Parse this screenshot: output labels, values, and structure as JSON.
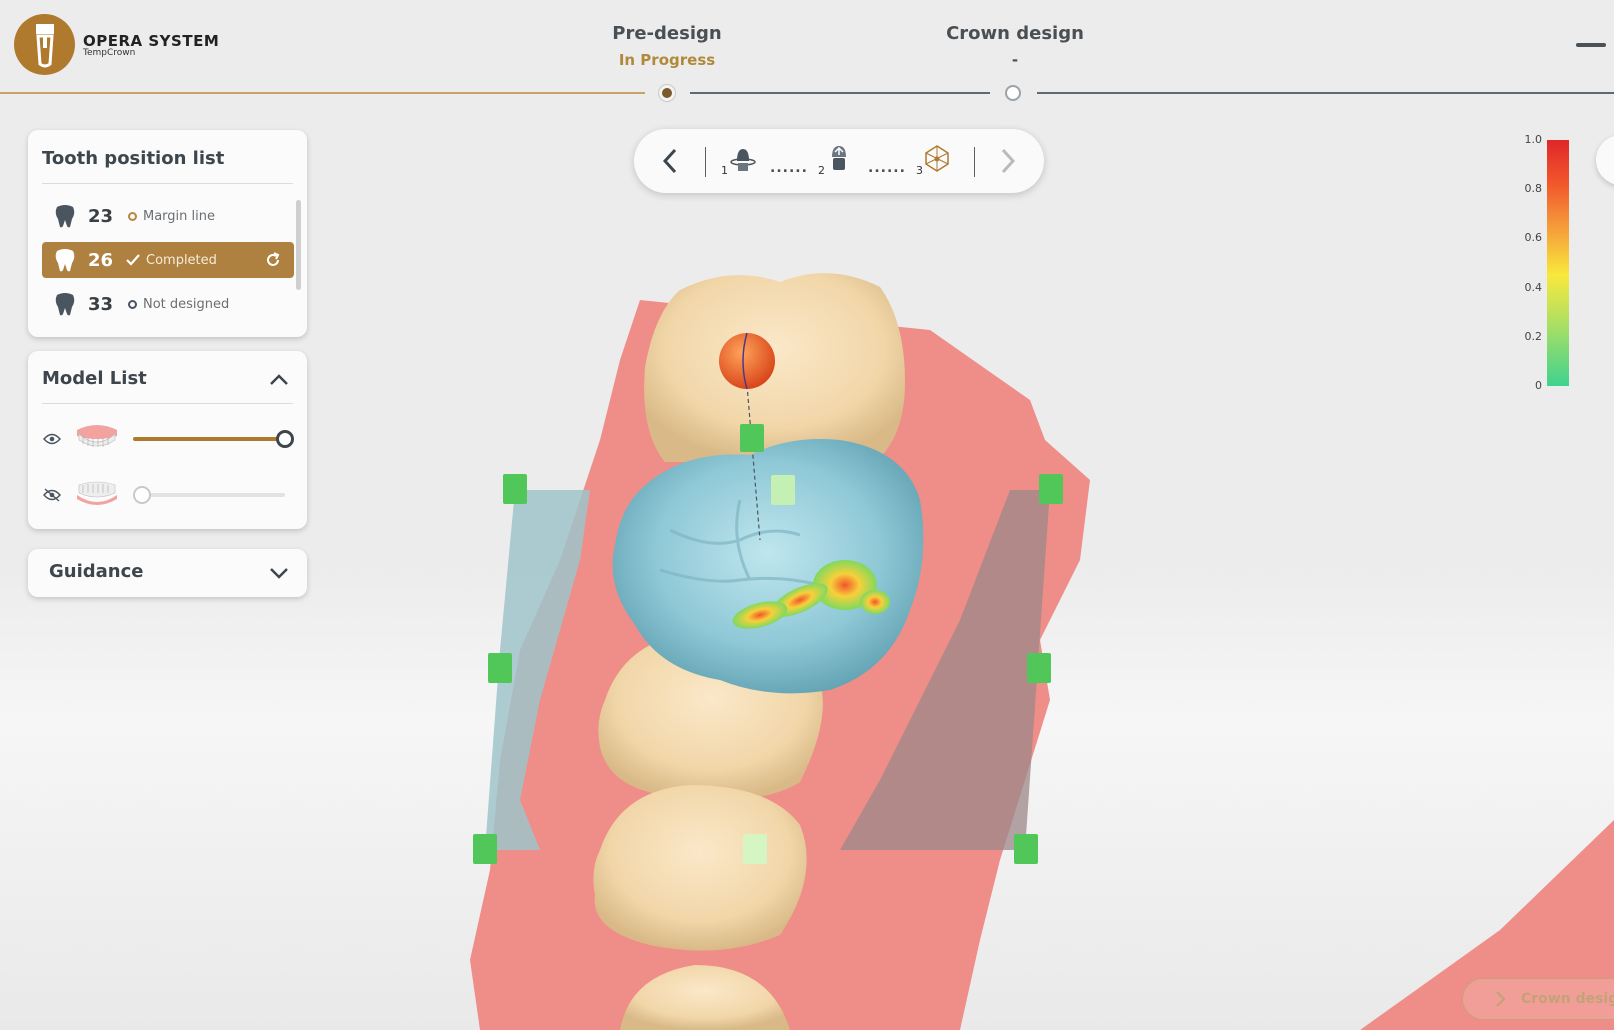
{
  "app": {
    "name": "OPERA SYSTEM",
    "subtitle": "TempCrown"
  },
  "steps": [
    {
      "label": "Pre-design",
      "status": "In Progress"
    },
    {
      "label": "Crown design",
      "status": "-"
    }
  ],
  "colors": {
    "accent": "#b07a2e",
    "status_active": "#b08a3a",
    "inactive_line": "#5d6a72"
  },
  "tooth_panel": {
    "title": "Tooth position list",
    "items": [
      {
        "number": "23",
        "status": "Margin line",
        "state": "in-progress"
      },
      {
        "number": "26",
        "status": "Completed",
        "state": "completed",
        "selected": true
      },
      {
        "number": "33",
        "status": "Not designed",
        "state": "not-designed"
      }
    ]
  },
  "model_panel": {
    "title": "Model List",
    "models": [
      {
        "name": "upper-jaw-model",
        "visible": true,
        "opacity": 1.0
      },
      {
        "name": "lower-jaw-model",
        "visible": false,
        "opacity": 0.0
      }
    ]
  },
  "guidance_panel": {
    "title": "Guidance"
  },
  "toolbar": {
    "steps": [
      "1",
      "2",
      "3"
    ],
    "dots": "......"
  },
  "color_scale": {
    "labels": [
      "1.0",
      "0.8",
      "0.6",
      "0.4",
      "0.2",
      "0"
    ]
  },
  "next_button": {
    "label": "Crown design"
  }
}
